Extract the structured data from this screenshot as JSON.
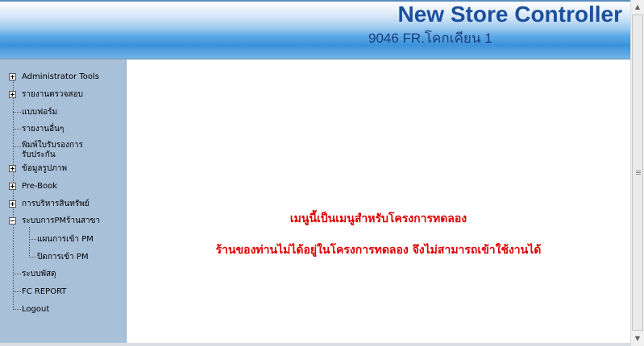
{
  "header": {
    "title": "New Store Controller",
    "subtitle": "9046 FR.โคกเคียน 1"
  },
  "sidebar": {
    "items": [
      {
        "label": "Administrator Tools",
        "expander": "plus"
      },
      {
        "label": "รายงานตรวจสอบ",
        "expander": "plus"
      },
      {
        "label": "แบบฟอร์ม",
        "expander": "none"
      },
      {
        "label": "รายงานอื่นๆ",
        "expander": "none"
      },
      {
        "label": "พิมพ์ใบรับรองการ",
        "label2": "รับประกัน",
        "expander": "none"
      },
      {
        "label": "ข้อมูลรูปภาพ",
        "expander": "plus"
      },
      {
        "label": "Pre-Book",
        "expander": "plus"
      },
      {
        "label": "การบริหารสินทรัพย์",
        "expander": "plus"
      },
      {
        "label": "ระบบการPMร้านสาขา",
        "expander": "minus",
        "children": [
          {
            "label": "แผนการเข้า PM"
          },
          {
            "label": "ปิดการเข้า PM"
          }
        ]
      },
      {
        "label": "ระบบพัสดุ",
        "expander": "none"
      },
      {
        "label": "FC REPORT",
        "expander": "none"
      },
      {
        "label": "Logout",
        "expander": "none"
      }
    ]
  },
  "content": {
    "message_line1": "เมนูนี้เป็นเมนูสำหรับโครงการทดลอง",
    "message_line2": "ร้านของท่านไม่ได้อยู่ในโครงการทดลอง จึงไม่สามารถเข้าใช้งานได้"
  },
  "colors": {
    "title": "#1a4f9c",
    "sidebar_bg": "#a9c0d9",
    "message": "#e00000"
  },
  "scrollbar": {
    "up_icon": "arrow-up-icon",
    "down_icon": "arrow-down-icon"
  }
}
